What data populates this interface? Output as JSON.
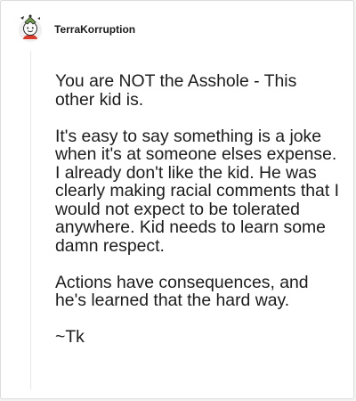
{
  "comment": {
    "author": "TerraKorruption",
    "avatar_icon": "snoo-avatar-icon",
    "paragraphs": [
      "You are NOT the Asshole - This other kid is.",
      "It's easy to say something is a joke when it's at someone elses expense. I already don't like the kid. He was clearly making racial comments that I would not expect to be tolerated anywhere. Kid needs to learn some damn respect.",
      "Actions have consequences, and he's learned that the hard way.",
      "~Tk"
    ]
  },
  "colors": {
    "background": "#ffffff",
    "text": "#1c1c1c",
    "avatar_accent": "#d93a2b",
    "avatar_secondary": "#6fa24a"
  }
}
